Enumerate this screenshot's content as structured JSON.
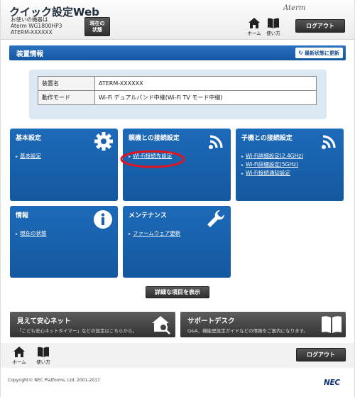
{
  "header": {
    "app_title": "クイック設定Web",
    "device_line1": "お使いの機器は",
    "device_line2": "Aterm WG1800HP3",
    "device_line3": "ATERM-XXXXXX",
    "status_btn_line1": "現在の",
    "status_btn_line2": "状態",
    "brand": "Aterm",
    "home_label": "ホーム",
    "usage_label": "使い方",
    "logout_label": "ログアウト"
  },
  "device_info": {
    "title": "装置情報",
    "refresh_label": "最新状態に更新",
    "rows": [
      {
        "key": "装置名",
        "value": "ATERM-XXXXXX"
      },
      {
        "key": "動作モード",
        "value": "Wi-Fi デュアルバンド中継(Wi-Fi TV モード中継)"
      }
    ]
  },
  "tiles": {
    "basic": {
      "title": "基本設定",
      "links": [
        "基本設定"
      ],
      "icon": "gear-icon"
    },
    "parent": {
      "title": "親機との接続設定",
      "links": [
        "Wi-Fi接続先設定"
      ],
      "icon": "wifi-icon"
    },
    "child": {
      "title": "子機との接続設定",
      "links": [
        "Wi-Fi詳細設定(2.4GHz)",
        "Wi-Fi詳細設定(5GHz)",
        "Wi-Fi接続通知設定"
      ],
      "icon": "wifi-icon"
    },
    "info": {
      "title": "情報",
      "links": [
        "現在の状態"
      ],
      "icon": "info-icon"
    },
    "maint": {
      "title": "メンテナンス",
      "links": [
        "ファームウェア更新"
      ],
      "icon": "wrench-icon"
    }
  },
  "detail_btn_label": "詳細な項目を表示",
  "banners": {
    "mimamori": {
      "title": "見えて安心ネット",
      "text": "「こども安心ネットタイマー」などの設定はこちらから。",
      "icon": "house-search-icon"
    },
    "support": {
      "title": "サポートデスク",
      "text": "Q&A、機能里設定ガイドなどの情報をご案内になります。",
      "icon": "book-icon"
    }
  },
  "footer": {
    "home_label": "ホーム",
    "usage_label": "使い方",
    "logout_label": "ログアウト",
    "copyright": "Copyright© NEC Platforms, Ltd. 2001-2017",
    "logo": "NEC"
  },
  "colors": {
    "tile_blue": "#1a62b0",
    "header_bar": "#1f63ad",
    "highlight_ring": "#e0141e"
  }
}
